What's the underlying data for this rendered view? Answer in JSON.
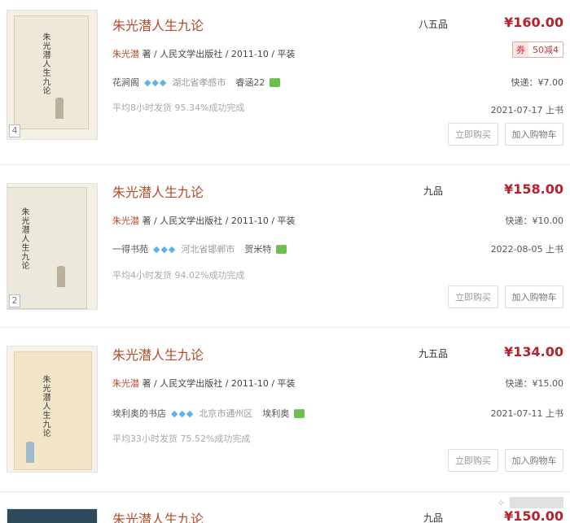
{
  "listings": [
    {
      "title": "朱光潜人生九论",
      "author": "朱光潜",
      "pub_info": "著 / 人民文学出版社 / 2011-10 / 平装",
      "condition": "八五品",
      "price": "¥160.00",
      "coupon_tag": "券",
      "coupon_text": "50减4",
      "shop_name": "花涧阁",
      "shop_location": "湖北省孝感市",
      "seller": "睿涵22",
      "stats": "平均8小时发货   95.34%成功完成",
      "shipping": "快递：¥7.00",
      "listed_date": "2021-07-17 上书",
      "buy_label": "立即购买",
      "cart_label": "加入购物车",
      "photo_count": "4",
      "cover_title": "朱光潜人生九论"
    },
    {
      "title": "朱光潜人生九论",
      "author": "朱光潜",
      "pub_info": "著 / 人民文学出版社 / 2011-10 / 平装",
      "condition": "九品",
      "price": "¥158.00",
      "shop_name": "一得书苑",
      "shop_location": "河北省邯郸市",
      "seller": "贺米特",
      "stats": "平均4小时发货   94.02%成功完成",
      "shipping": "快递：¥10.00",
      "listed_date": "2022-08-05 上书",
      "buy_label": "立即购买",
      "cart_label": "加入购物车",
      "photo_count": "2",
      "cover_title": "朱光潜人生九论"
    },
    {
      "title": "朱光潜人生九论",
      "author": "朱光潜",
      "pub_info": "著 / 人民文学出版社 / 2011-10 / 平装",
      "condition": "九五品",
      "price": "¥134.00",
      "shop_name": "埃利奥的书店",
      "shop_location": "北京市通州区",
      "seller": "埃利奥",
      "stats": "平均33小时发货   75.52%成功完成",
      "shipping": "快递：¥15.00",
      "listed_date": "2021-07-11 上书",
      "buy_label": "立即购买",
      "cart_label": "加入购物车",
      "cover_title": "朱光潜人生九论"
    },
    {
      "title": "朱光潜人生九论",
      "condition": "九品",
      "price": "¥150.00"
    }
  ],
  "icons": {
    "membership": "diamond-icon",
    "chat": "chat-icon"
  },
  "colors": {
    "price": "#b8202a",
    "title": "#b44a2a",
    "diamond": "#5fb3e8",
    "chat": "#6bbf4a"
  }
}
